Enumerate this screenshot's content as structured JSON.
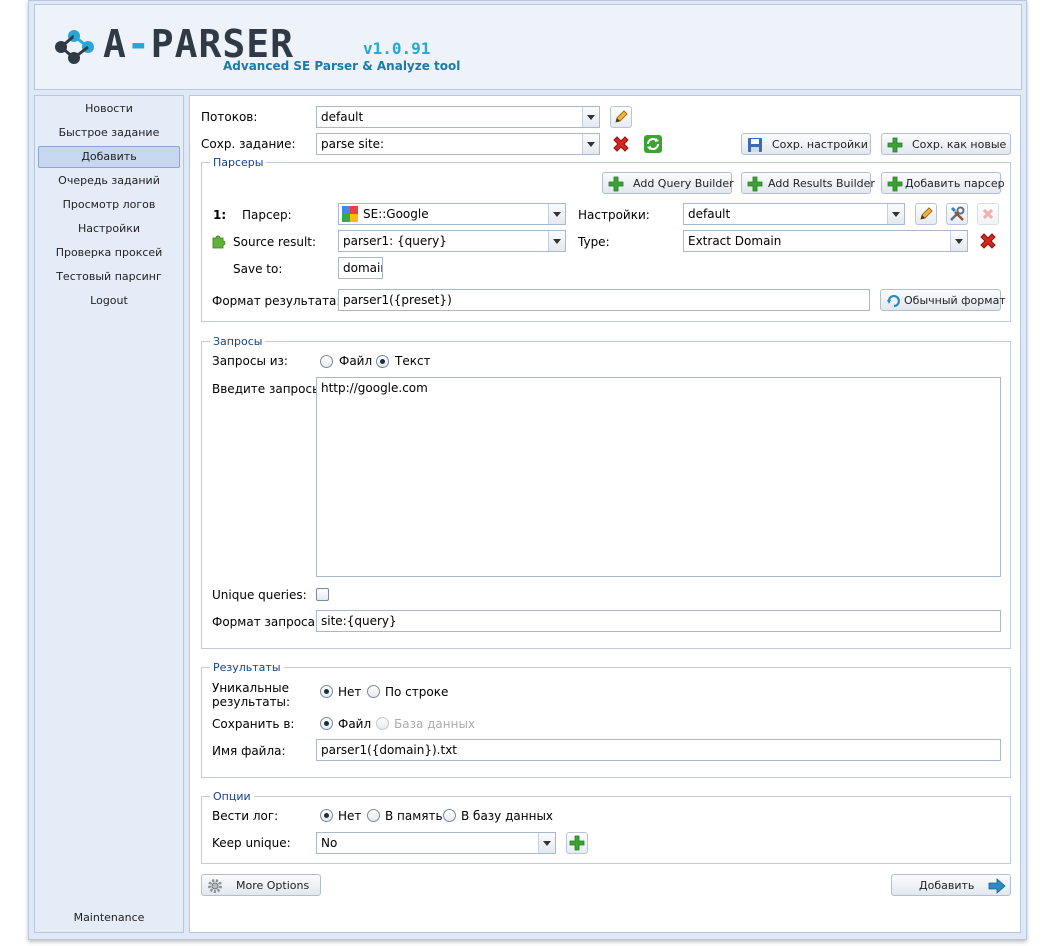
{
  "header": {
    "logo_word": "A-PARSER",
    "version": "v1.0.91",
    "tagline": "Advanced SE Parser & Analyze tool"
  },
  "sidebar": {
    "items": [
      {
        "label": "Новости"
      },
      {
        "label": "Быстрое задание"
      },
      {
        "label": "Добавить",
        "active": true
      },
      {
        "label": "Очередь заданий"
      },
      {
        "label": "Просмотр логов"
      },
      {
        "label": "Настройки"
      },
      {
        "label": "Проверка проксей"
      },
      {
        "label": "Тестовый парсинг"
      },
      {
        "label": "Logout"
      }
    ],
    "maintenance": "Maintenance"
  },
  "top": {
    "threads_label": "Потоков:",
    "threads_value": "default",
    "save_task_label": "Сохр. задание:",
    "save_task_value": "parse site:",
    "save_settings_btn": "Сохр. настройки",
    "save_as_new_btn": "Сохр. как новые"
  },
  "parsers": {
    "legend": "Парсеры",
    "add_query_builder": "Add Query Builder",
    "add_results_builder": "Add Results Builder",
    "add_parser": "Добавить парсер",
    "index": "1:",
    "parser_label": "Парсер:",
    "parser_value": "SE::Google",
    "settings_label": "Настройки:",
    "settings_value": "default",
    "source_label": "Source result:",
    "source_value": "parser1: {query}",
    "type_label": "Type:",
    "type_value": "Extract Domain",
    "save_to_label": "Save to:",
    "save_to_value": "domain",
    "result_format_label": "Формат результата:",
    "result_format_value": "parser1({preset})",
    "default_format_btn": "Обычный формат"
  },
  "queries": {
    "legend": "Запросы",
    "from_label": "Запросы из:",
    "opt_file": "Файл",
    "opt_text": "Текст",
    "selected": "text",
    "enter_label": "Введите запросы:",
    "text": "http://google.com",
    "unique_label": "Unique queries:",
    "unique_checked": false,
    "format_label": "Формат запроса:",
    "format_value": "site:{query}"
  },
  "results": {
    "legend": "Результаты",
    "unique_label_1": "Уникальные",
    "unique_label_2": "результаты:",
    "opt_no": "Нет",
    "opt_by_line": "По строке",
    "save_in_label": "Сохранить в:",
    "opt_file": "Файл",
    "opt_db": "База данных",
    "filename_label": "Имя файла:",
    "filename_value": "parser1({domain}).txt"
  },
  "options": {
    "legend": "Опции",
    "log_label": "Вести лог:",
    "opt_no": "Нет",
    "opt_memory": "В память",
    "opt_db": "В базу данных",
    "keep_unique_label": "Keep unique:",
    "keep_unique_value": "No"
  },
  "footer": {
    "more_options": "More Options",
    "add": "Добавить"
  },
  "colors": {
    "frame_bg": "#dfe8f6",
    "legend_text": "#15428b",
    "logo_accent": "#29a6d6",
    "delete_red": "#d9261c",
    "add_green": "#3aa334"
  }
}
